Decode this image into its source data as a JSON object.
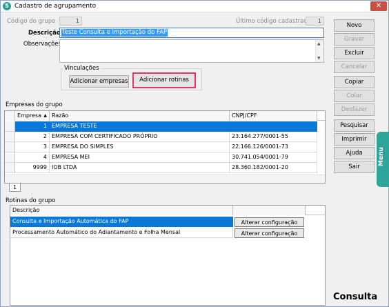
{
  "window": {
    "title": "Cadastro de agrupamento",
    "close_glyph": "✕",
    "app_icon": "S"
  },
  "form": {
    "codigo_label": "Código do grupo",
    "codigo_value": "1",
    "ultimo_label": "Último código cadastrado",
    "ultimo_value": "1",
    "descricao_label": "Descrição",
    "descricao_value": "Teste Consulta e Importação do FAP",
    "observacoes_label": "Observações",
    "observacoes_value": "",
    "vinculacoes_label": "Vinculações",
    "add_empresas_label": "Adicionar empresas",
    "add_rotinas_label": "Adicionar rotinas"
  },
  "toolbar": [
    {
      "label": "Novo",
      "enabled": true
    },
    {
      "label": "Gravar",
      "enabled": false
    },
    {
      "label": "Excluir",
      "enabled": true
    },
    {
      "label": "Cancelar",
      "enabled": false
    },
    {
      "label": "Copiar",
      "enabled": true
    },
    {
      "label": "Colar",
      "enabled": false
    },
    {
      "label": "Desfazer",
      "enabled": false
    },
    {
      "label": "Pesquisar",
      "enabled": true
    },
    {
      "label": "Imprimir",
      "enabled": true
    },
    {
      "label": "Ajuda",
      "enabled": true
    },
    {
      "label": "Sair",
      "enabled": true
    }
  ],
  "empresas": {
    "section_label": "Empresas do grupo",
    "columns": [
      "Empresa",
      "Razão",
      "CNPJ/CPF"
    ],
    "sort_glyph": "▲",
    "rows": [
      {
        "empresa": "1",
        "razao": "EMPRESA TESTE",
        "cnpj": "",
        "selected": true
      },
      {
        "empresa": "2",
        "razao": "EMPRESA COM CERTIFICADO PRÓPRIO",
        "cnpj": "23.164.277/0001-55",
        "selected": false
      },
      {
        "empresa": "3",
        "razao": "EMPRESA DO SIMPLES",
        "cnpj": "22.166.126/0001-73",
        "selected": false
      },
      {
        "empresa": "4",
        "razao": "EMPRESA MEI",
        "cnpj": "30.741.054/0001-79",
        "selected": false
      },
      {
        "empresa": "9999",
        "razao": "IOB LTDA",
        "cnpj": "28.360.182/0001-20",
        "selected": false
      }
    ],
    "tab_label": "1"
  },
  "rotinas": {
    "section_label": "Rotinas do grupo",
    "column": "Descrição",
    "rows": [
      {
        "descricao": "Consulta e Importação Automática do FAP",
        "button": "Alterar configuração",
        "selected": true
      },
      {
        "descricao": "Processamento Automático do Adiantamento e Folha Mensal",
        "button": "Alterar configuração",
        "selected": false
      }
    ]
  },
  "side_menu_label": "Menu",
  "mode_label": "Consulta",
  "colors": {
    "selection": "#0a78d7",
    "highlight_border": "#e0336b",
    "menu_tab": "#2ea59a"
  },
  "icons": [
    "app-icon",
    "close-icon",
    "sort-asc-icon",
    "scroll-up-icon",
    "scroll-down-icon"
  ]
}
